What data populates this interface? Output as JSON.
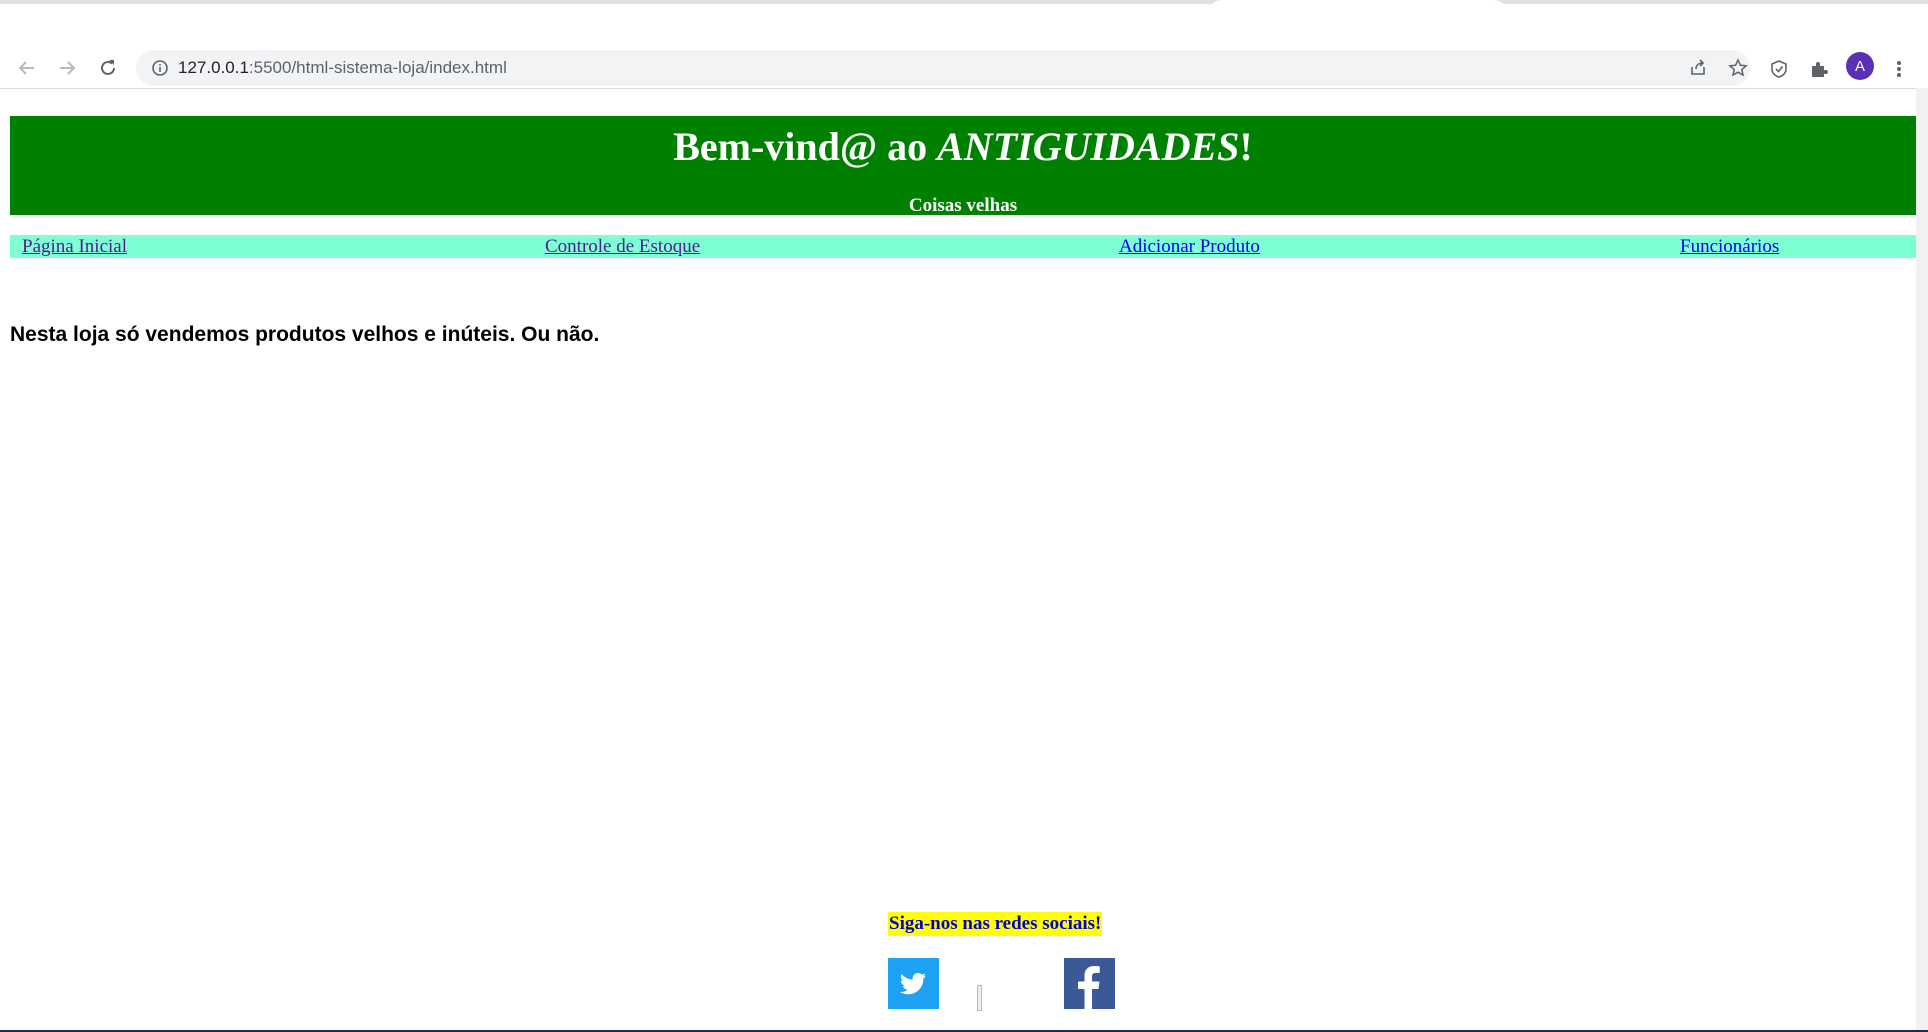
{
  "browser": {
    "url_host": "127.0.0.1",
    "url_rest": ":5500/html-sistema-loja/index.html",
    "profile_initial": "A",
    "icons": [
      "back-icon",
      "forward-icon",
      "reload-icon",
      "site-info-icon",
      "share-icon",
      "bookmark-star-icon",
      "shield-extension-icon",
      "extensions-puzzle-icon",
      "more-menu-icon"
    ]
  },
  "header": {
    "title_prefix": "Bem-vind@ ao ",
    "title_brand": "ANTIGUIDADES",
    "title_suffix": "!",
    "subtitle": "Coisas velhas",
    "background_color": "#008000"
  },
  "nav": {
    "background_color": "#7fffd4",
    "items": [
      {
        "label": "Página Inicial "
      },
      {
        "label": "Controle de Estoque "
      },
      {
        "label": "Adicionar Produto "
      },
      {
        "label": "Funcionários"
      }
    ]
  },
  "main": {
    "intro": "Nesta loja só vendemos produtos velhos e inúteis. Ou não."
  },
  "footer": {
    "social_title": "Siga-nos nas redes sociais!",
    "social_icons": [
      "twitter-icon",
      "facebook-icon"
    ]
  }
}
